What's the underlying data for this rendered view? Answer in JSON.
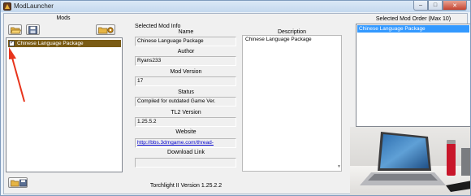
{
  "window": {
    "title": "ModLauncher",
    "minimize": "–",
    "maximize": "□",
    "close": "✕"
  },
  "mods_panel": {
    "heading": "Mods",
    "items": [
      {
        "label": "Chinese Language Package",
        "checked": true,
        "check_glyph": "✓"
      }
    ]
  },
  "info_panel": {
    "heading": "Selected Mod Info",
    "fields": [
      {
        "title": "Name",
        "value": "Chinese Language Package"
      },
      {
        "title": "Author",
        "value": "Ryans233"
      },
      {
        "title": "Mod Version",
        "value": "17"
      },
      {
        "title": "Status",
        "value": "Compiled for outdated Game Ver."
      },
      {
        "title": "TL2 Version",
        "value": "1.25.5.2"
      },
      {
        "title": "Website",
        "value": "http://bbs.3dmgame.com/thread-"
      },
      {
        "title": "Download Link",
        "value": ""
      }
    ],
    "description_title": "Description",
    "description_value": "Chinese Language Package"
  },
  "order_panel": {
    "heading": "Selected Mod Order (Max 10)",
    "items": [
      "Chinese Language Package"
    ]
  },
  "footer": {
    "version": "Torchlight II Version 1.25.2.2"
  },
  "colors": {
    "selected_mod_bg": "#7a5b14",
    "order_selected_bg": "#3399ff",
    "annotation_arrow": "#e8341c",
    "link": "#0000cc"
  },
  "icons": [
    "app-icon",
    "open-folder-icon",
    "save-icon",
    "folder-gear-icon",
    "annotation-arrow"
  ]
}
